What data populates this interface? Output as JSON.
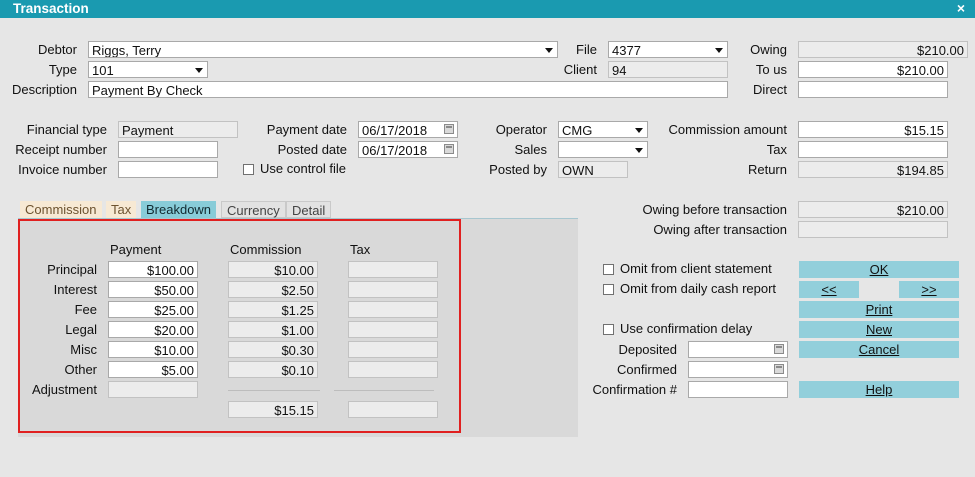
{
  "window": {
    "title": "Transaction",
    "close_glyph": "×"
  },
  "labels": {
    "debtor": "Debtor",
    "type": "Type",
    "description": "Description",
    "file": "File",
    "client": "Client",
    "owing": "Owing",
    "to_us": "To us",
    "direct": "Direct",
    "financial_type": "Financial type",
    "receipt_number": "Receipt number",
    "invoice_number": "Invoice number",
    "payment_date": "Payment date",
    "posted_date": "Posted date",
    "use_control_file": "Use control file",
    "operator": "Operator",
    "sales": "Sales",
    "posted_by": "Posted by",
    "commission_amount": "Commission amount",
    "tax": "Tax",
    "return": "Return",
    "owing_before": "Owing before transaction",
    "owing_after": "Owing after transaction"
  },
  "values": {
    "debtor": "Riggs, Terry",
    "type": "101",
    "description": "Payment By Check",
    "file": "4377",
    "client": "94",
    "owing": "$210.00",
    "to_us": "$210.00",
    "direct": "",
    "financial_type": "Payment",
    "receipt_number": "",
    "invoice_number": "",
    "payment_date": "06/17/2018",
    "posted_date": "06/17/2018",
    "operator": "CMG",
    "sales": "",
    "posted_by": "OWN",
    "commission_amount": "$15.15",
    "tax": "",
    "return": "$194.85",
    "owing_before": "$210.00",
    "owing_after": ""
  },
  "tabs": [
    "Commission",
    "Tax",
    "Breakdown",
    "Currency",
    "Detail"
  ],
  "breakdown": {
    "headers": {
      "payment": "Payment",
      "commission": "Commission",
      "tax": "Tax"
    },
    "rows": [
      {
        "label": "Principal",
        "payment": "$100.00",
        "commission": "$10.00",
        "tax": ""
      },
      {
        "label": "Interest",
        "payment": "$50.00",
        "commission": "$2.50",
        "tax": ""
      },
      {
        "label": "Fee",
        "payment": "$25.00",
        "commission": "$1.25",
        "tax": ""
      },
      {
        "label": "Legal",
        "payment": "$20.00",
        "commission": "$1.00",
        "tax": ""
      },
      {
        "label": "Misc",
        "payment": "$10.00",
        "commission": "$0.30",
        "tax": ""
      },
      {
        "label": "Other",
        "payment": "$5.00",
        "commission": "$0.10",
        "tax": ""
      }
    ],
    "adjustment_label": "Adjustment",
    "adjustment_value": "",
    "commission_total": "$15.15",
    "tax_total": ""
  },
  "options": {
    "omit_client_statement": "Omit from client statement",
    "omit_daily_cash": "Omit from daily cash report",
    "use_confirmation_delay": "Use confirmation delay",
    "deposited": "Deposited",
    "confirmed": "Confirmed",
    "confirmation_no": "Confirmation #"
  },
  "buttons": {
    "ok": "OK",
    "prev": "<<",
    "next": ">>",
    "print": "Print",
    "new": "New",
    "cancel": "Cancel",
    "help": "Help"
  }
}
